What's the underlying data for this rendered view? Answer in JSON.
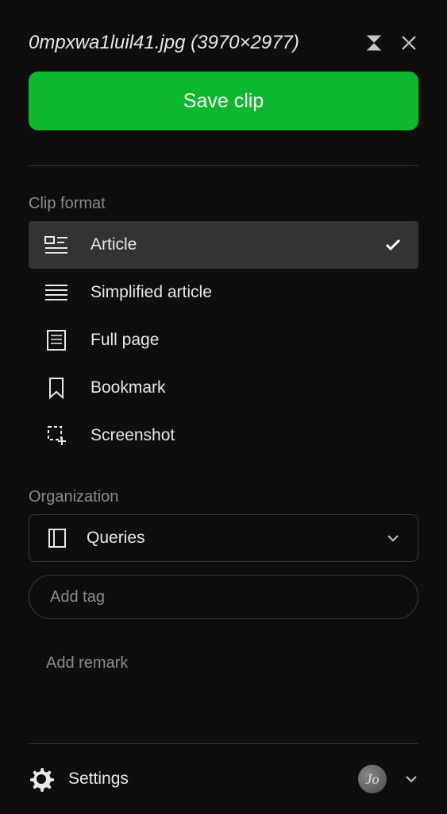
{
  "header": {
    "title": "0mpxwa1luil41.jpg (3970×2977)"
  },
  "save_button": {
    "label": "Save clip"
  },
  "clip_format": {
    "section_label": "Clip format",
    "items": [
      {
        "id": "article",
        "label": "Article",
        "selected": true
      },
      {
        "id": "simplified-article",
        "label": "Simplified article",
        "selected": false
      },
      {
        "id": "full-page",
        "label": "Full page",
        "selected": false
      },
      {
        "id": "bookmark",
        "label": "Bookmark",
        "selected": false
      },
      {
        "id": "screenshot",
        "label": "Screenshot",
        "selected": false
      }
    ]
  },
  "organization": {
    "section_label": "Organization",
    "notebook": "Queries",
    "tag_placeholder": "Add tag",
    "remark_label": "Add remark"
  },
  "footer": {
    "settings_label": "Settings",
    "avatar_initials": "Jo"
  }
}
